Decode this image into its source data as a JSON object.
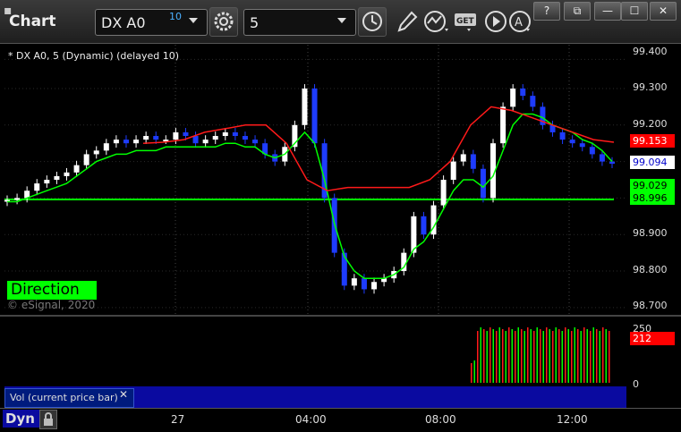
{
  "window": {
    "title": "Chart"
  },
  "toolbar": {
    "symbol": "DX A0",
    "symbol_badge": "10",
    "interval": "5",
    "icons": [
      "settings-icon",
      "clock-icon",
      "pencil-icon",
      "study-icon",
      "get-icon",
      "play-icon",
      "alert-icon"
    ],
    "get_label": "GET"
  },
  "window_buttons": {
    "help": "?",
    "restore": "⧉",
    "minimize": "—",
    "maximize": "☐",
    "close": "✕"
  },
  "chart_header": "* DX A0, 5 (Dynamic) (delayed 10)",
  "direction_label": "Direction",
  "copyright": "© eSignal, 2020",
  "price_axis": {
    "labels": [
      "99.400",
      "99.300",
      "99.200",
      "98.900",
      "98.800",
      "98.700"
    ],
    "tags": [
      {
        "text": "99.153",
        "bg": "#ff0000",
        "fg": "#ffffff"
      },
      {
        "text": "99.094",
        "bg": "#ffffff",
        "fg": "#0000cc"
      },
      {
        "text": "99.029",
        "bg": "#00ff00",
        "fg": "#000000"
      },
      {
        "text": "98.996",
        "bg": "#00ff00",
        "fg": "#000000"
      }
    ]
  },
  "volume": {
    "label": "Vol (current price bar)",
    "close": "✕",
    "axis": [
      "250",
      "0"
    ],
    "tag": "212"
  },
  "time_axis": {
    "labels": [
      "27",
      "04:00",
      "08:00",
      "12:00"
    ]
  },
  "bottom": {
    "mode": "Dyn"
  },
  "colors": {
    "up": "#ffffff",
    "down": "#1e3cff",
    "ma_fast": "#00ff00",
    "ma_slow": "#ff1a1a",
    "accent": "#00ff00"
  },
  "chart_data": {
    "type": "line",
    "y_range": [
      98.68,
      99.42
    ],
    "series": [
      {
        "values": [
          98.995,
          99.0,
          99.02,
          99.04,
          99.05,
          99.06,
          99.07,
          99.09,
          99.12,
          99.13,
          99.15,
          99.16,
          99.15,
          99.16,
          99.17,
          99.16,
          99.16,
          99.18,
          99.17,
          99.15,
          99.16,
          99.17,
          99.18,
          99.17,
          99.16,
          99.15,
          99.12,
          99.1,
          99.14,
          99.2,
          99.3,
          99.15,
          99.0,
          98.85,
          98.76,
          98.78,
          98.75,
          98.77,
          98.78,
          98.8,
          98.85,
          98.95,
          98.9,
          98.98,
          99.05,
          99.1,
          99.12,
          99.08,
          99.0,
          99.15,
          99.25,
          99.3,
          99.28,
          99.25,
          99.2,
          99.18,
          99.16,
          99.15,
          99.14,
          99.12,
          99.1,
          99.094
        ]
      },
      {
        "values": [
          98.99,
          98.99,
          99.0,
          99.01,
          99.02,
          99.03,
          99.04,
          99.06,
          99.08,
          99.1,
          99.11,
          99.12,
          99.12,
          99.13,
          99.13,
          99.13,
          99.14,
          99.14,
          99.14,
          99.14,
          99.14,
          99.14,
          99.15,
          99.15,
          99.14,
          99.14,
          99.12,
          99.11,
          99.12,
          99.15,
          99.18,
          99.15,
          99.05,
          98.93,
          98.84,
          98.8,
          98.78,
          98.78,
          98.78,
          98.79,
          98.81,
          98.86,
          98.88,
          98.92,
          98.97,
          99.02,
          99.05,
          99.05,
          99.03,
          99.06,
          99.13,
          99.2,
          99.23,
          99.23,
          99.22,
          99.2,
          99.19,
          99.18,
          99.16,
          99.15,
          99.13,
          99.1
        ]
      },
      {
        "values": [
          99.15,
          99.153,
          99.16,
          99.18,
          99.19,
          99.2,
          99.2,
          99.15,
          99.05,
          99.02,
          99.029,
          99.029,
          99.029,
          99.029,
          99.05,
          99.1,
          99.2,
          99.25,
          99.24,
          99.22,
          99.2,
          99.18,
          99.16,
          99.153
        ]
      }
    ]
  }
}
